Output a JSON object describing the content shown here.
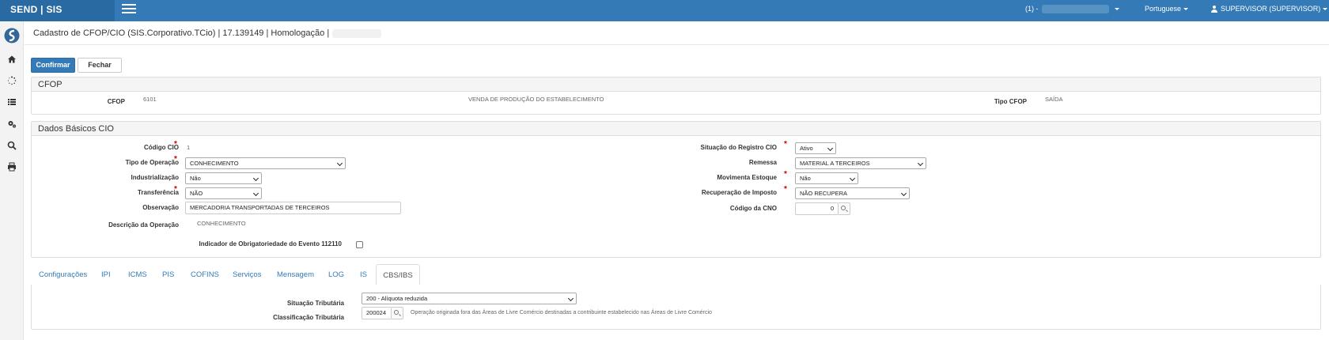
{
  "header": {
    "brand": "SEND  |  SIS",
    "company_prefix": "(1) -",
    "language": "Portuguese",
    "user": "SUPERVISOR (SUPERVISOR)"
  },
  "page": {
    "title": "Cadastro de CFOP/CIO (SIS.Corporativo.TCio) | 17.139149 | Homologação |"
  },
  "actions": {
    "confirm_label": "Confirmar",
    "close_label": "Fechar"
  },
  "cfop": {
    "panel_title": "CFOP",
    "cfop_label": "CFOP",
    "cfop_value": "6101",
    "cfop_description": "VENDA DE PRODUÇÃO DO ESTABELECIMENTO",
    "tipo_label": "Tipo CFOP",
    "tipo_value": "SAÍDA"
  },
  "cio": {
    "panel_title": "Dados Básicos CIO",
    "codigo_label": "Código CIO",
    "codigo_value": "1",
    "tipo_operacao_label": "Tipo de Operação",
    "tipo_operacao_value": "CONHECIMENTO",
    "industrializacao_label": "Industrialização",
    "industrializacao_value": "Não",
    "transferencia_label": "Transferência",
    "transferencia_value": "NÃO",
    "observacao_label": "Observação",
    "observacao_value": "MERCADORIA TRANSPORTADAS DE TERCEIROS",
    "descricao_label": "Descrição da Operação",
    "descricao_value": "CONHECIMENTO",
    "indicador_label": "Indicador de Obrigatoriedade do Evento 112110",
    "situacao_label": "Situação do Registro CIO",
    "situacao_value": "Ativo",
    "remessa_label": "Remessa",
    "remessa_value": "MATERIAL A TERCEIROS",
    "movimenta_label": "Movimenta Estoque",
    "movimenta_value": "Não",
    "recuperacao_label": "Recuperação de Imposto",
    "recuperacao_value": "NÃO RECUPERA",
    "cno_label": "Código da CNO",
    "cno_value": "0"
  },
  "tabs": [
    "Configurações",
    "IPI",
    "ICMS",
    "PIS",
    "COFINS",
    "Serviços",
    "Mensagem",
    "LOG",
    "IS",
    "CBS/IBS"
  ],
  "active_tab": "CBS/IBS",
  "cbs": {
    "situacao_label": "Situação Tributária",
    "situacao_value": "200 - Alíquota reduzida",
    "classificacao_label": "Classificação Tributária",
    "classificacao_value": "200024",
    "classificacao_desc": "Operação originada fora das Áreas de Livre Comércio destinadas a contribuinte estabelecido nas Áreas de Livre Comércio"
  },
  "icons": [
    "home-icon",
    "spinner-icon",
    "list-icon",
    "gears-icon",
    "search-icon",
    "print-icon"
  ],
  "colors": {
    "primary": "#337ab7",
    "brand_bg": "#2a6aa3",
    "required": "#c00000"
  }
}
